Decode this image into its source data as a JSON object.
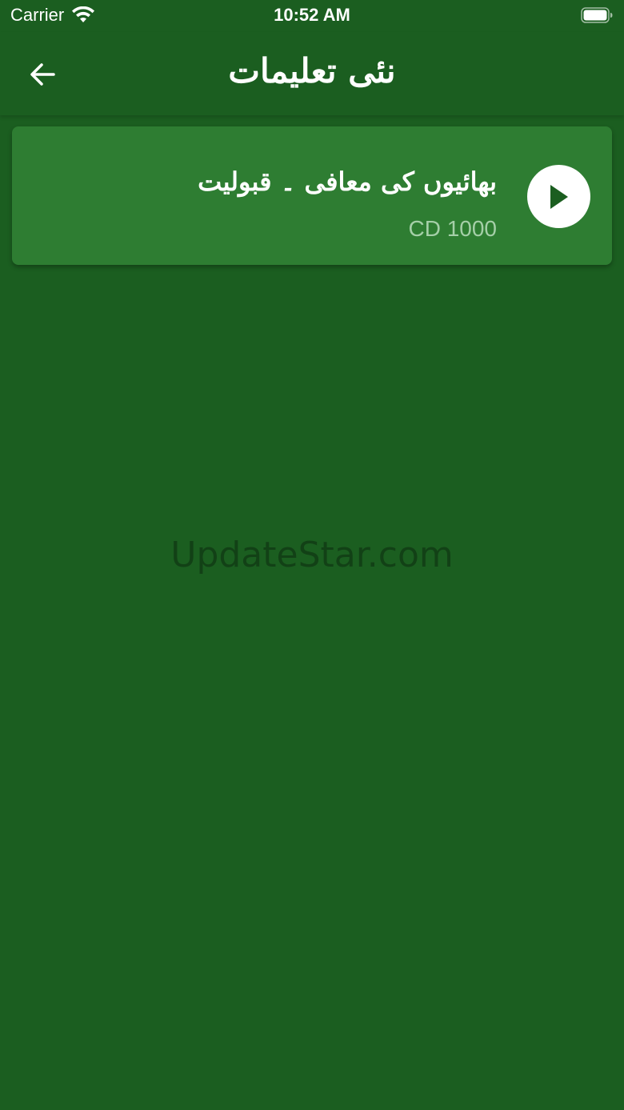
{
  "status_bar": {
    "carrier": "Carrier",
    "time": "10:52 AM",
    "wifi_icon": "wifi-icon",
    "battery_icon": "battery-icon"
  },
  "app_bar": {
    "title": "نئی تعلیمات",
    "back_icon": "arrow-left-icon"
  },
  "items": [
    {
      "title": "بھائیوں کی معافی ۔ قبولیت",
      "subtitle": "CD 1000",
      "icon": "play-icon"
    }
  ],
  "watermark": "UpdateStar.com",
  "colors": {
    "background": "#1b5e20",
    "card": "#2e7d32",
    "subtitle": "#a5cfa8",
    "text": "#ffffff"
  }
}
